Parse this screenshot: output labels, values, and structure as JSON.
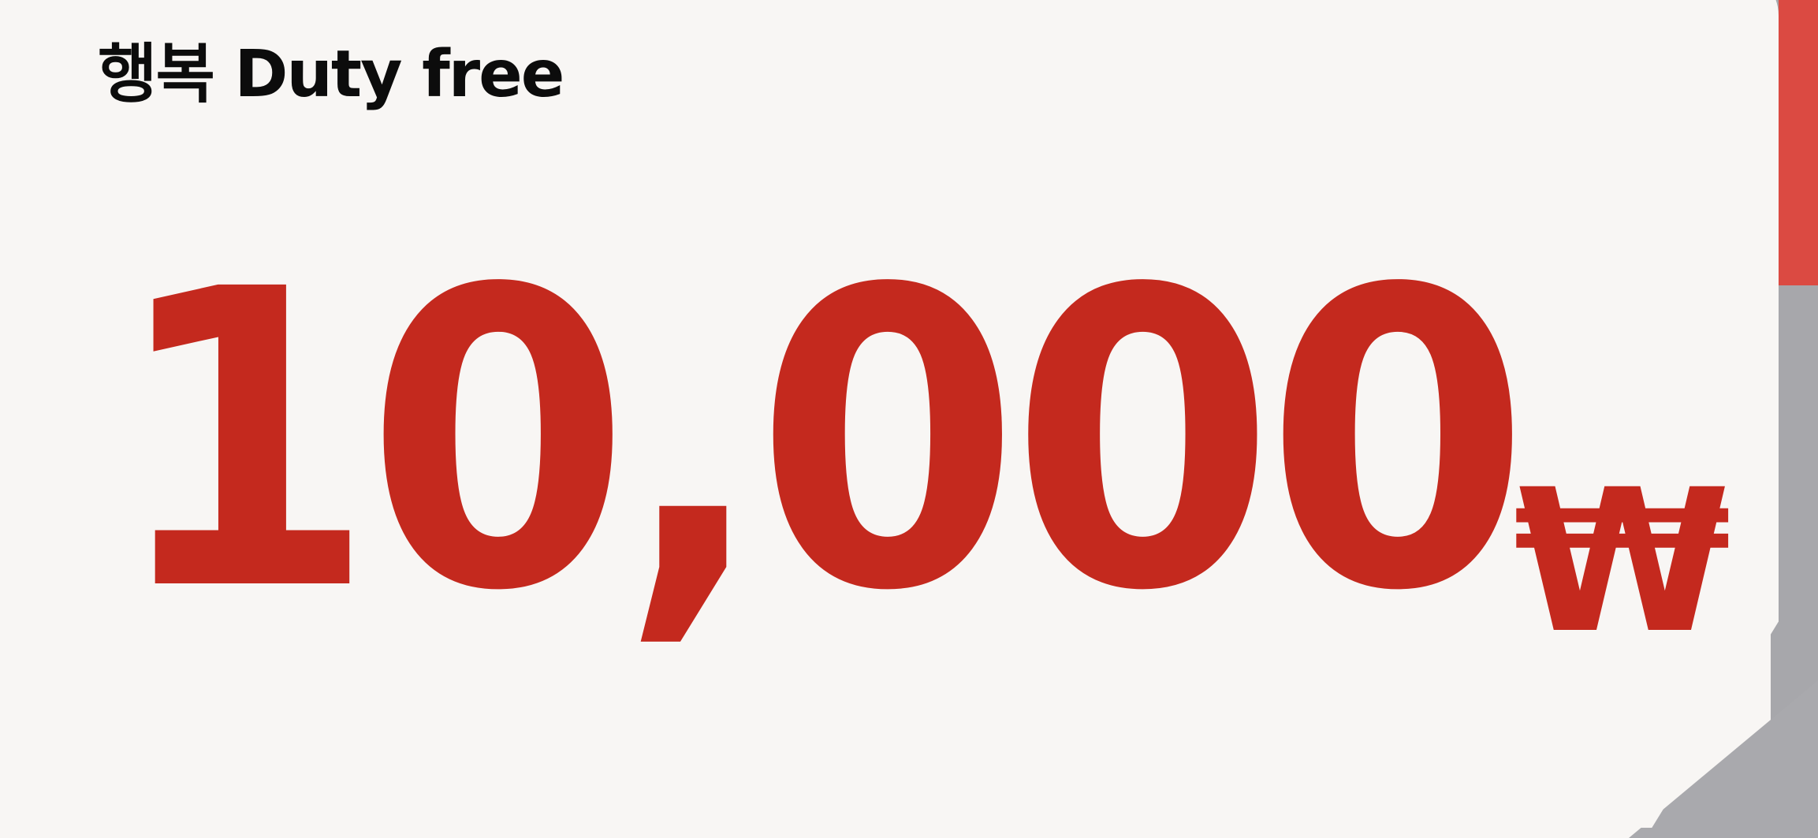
{
  "voucher": {
    "brand_name": "행복 Duty free",
    "amount": "10,000",
    "currency_symbol": "₩"
  },
  "colors": {
    "amount": "#c4291e",
    "brand_text": "#0c0c0c",
    "card_background": "#f8f6f4",
    "accent_strip": "#db4a42",
    "backdrop": "#a7a7ab"
  }
}
